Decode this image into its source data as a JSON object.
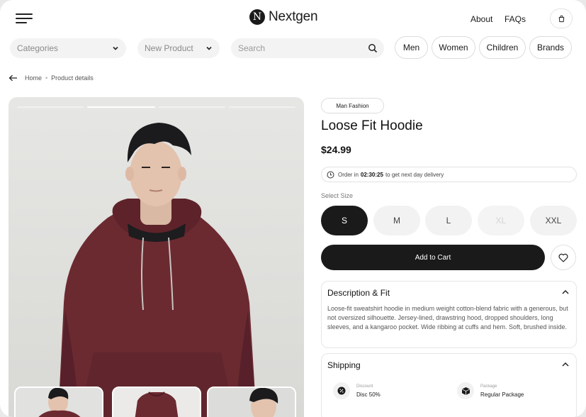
{
  "brand": {
    "logo_letter": "N",
    "name": "Nextgen"
  },
  "header": {
    "links": [
      "About",
      "FAQs"
    ]
  },
  "filters": {
    "categories_label": "Categories",
    "new_product_label": "New Product",
    "search_placeholder": "Search",
    "chips": [
      "Men",
      "Women",
      "Children",
      "Brands"
    ]
  },
  "breadcrumb": {
    "home": "Home",
    "separator": "•",
    "current": "Product details"
  },
  "product": {
    "tag": "Man Fashion",
    "title": "Loose Fit Hoodie",
    "price": "$24.99",
    "delivery_prefix": "Order in",
    "delivery_time": "02:30:25",
    "delivery_suffix": "to get next day delivery",
    "size_label": "Select Size",
    "sizes": [
      {
        "label": "S",
        "state": "selected"
      },
      {
        "label": "M",
        "state": "available"
      },
      {
        "label": "L",
        "state": "available"
      },
      {
        "label": "XL",
        "state": "unavailable"
      },
      {
        "label": "XXL",
        "state": "available"
      }
    ],
    "cart_label": "Add to Cart"
  },
  "description": {
    "heading": "Description & Fit",
    "text": "Loose-fit sweatshirt hoodie in medium weight cotton-blend fabric with a generous, but not oversized silhouette. Jersey-lined, drawstring hood, dropped shoulders, long sleeves, and a kangaroo pocket. Wide ribbing at cuffs and hem. Soft, brushed inside."
  },
  "shipping": {
    "heading": "Shipping",
    "items": [
      {
        "sub": "Discount",
        "value": "Disc 50%",
        "icon": "discount-icon"
      },
      {
        "sub": "Package",
        "value": "Regular Package",
        "icon": "package-icon"
      }
    ]
  },
  "gallery": {
    "active_slide": 2,
    "slide_count": 4,
    "thumbnail_count": 3
  },
  "colors": {
    "accent": "#1a1a1a",
    "hoodie": "#6b2a30"
  }
}
